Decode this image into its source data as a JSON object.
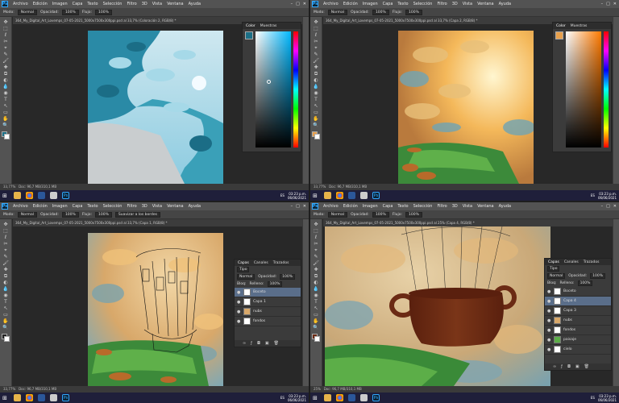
{
  "app": {
    "logo": "Ps",
    "menu": [
      "Archivo",
      "Edición",
      "Imagen",
      "Capa",
      "Texto",
      "Selección",
      "Filtro",
      "3D",
      "Vista",
      "Ventana",
      "Ayuda"
    ],
    "win_controls": [
      "–",
      "□",
      "✕"
    ],
    "options": {
      "mode_label": "Modo:",
      "mode_value": "Normal",
      "opacity_label": "Opacidad:",
      "opacity_value": "100%",
      "flow_label": "Flujo:",
      "flow_value": "100%"
    },
    "options_extra": "Suavizar a los bordes"
  },
  "tools": [
    "✥",
    "⬚",
    "ℓ",
    "✂",
    "⌖",
    "✎",
    "🖌",
    "✚",
    "⧉",
    "◐",
    "💧",
    "◉",
    "T",
    "↖",
    "▭",
    "✋",
    "🔍"
  ],
  "colors": {
    "brand": "#31a8ff",
    "menubar": "#535353",
    "taskbar": "#1f1f3a",
    "layer_selected": "#5a6e8a"
  },
  "quadrants": [
    {
      "tab": "364_My_Digital_Art_Lovemps_07-05-2021_5000x7500x300ppi.psd al 33,7% (Coloración 2, RGB/8) *",
      "status": "33,77%",
      "status_doc": "Doc: 96,7 MB/310,1 MB",
      "panel_tabs": [
        "Color",
        "Muestras"
      ]
    },
    {
      "tab": "364_My_Digital_Art_Lovemps_07-05-2021_5000x7500x300ppi.psd al 33,7% (Capa 2, RGB/8) *",
      "status": "33,77%",
      "status_doc": "Doc: 96,7 MB/310,1 MB",
      "panel_tabs": [
        "Color",
        "Muestras"
      ]
    },
    {
      "tab": "364_My_Digital_Art_Lovemps_07-05-2021_5000x7500x300ppi.psd al 33,7% (Capa 1, RGB/8) *",
      "status": "33,77%",
      "status_doc": "Doc: 96,7 MB/310,1 MB",
      "panel_tabs": [
        "Capas",
        "Canales",
        "Trazados"
      ],
      "layers_kind": "Tipo",
      "blend": "Normal",
      "opacity_label": "Opacidad:",
      "opacity": "100%",
      "lock_label": "Bloq:",
      "fill_label": "Relleno:",
      "fill": "100%",
      "layers": [
        "Boceto",
        "Capa 1",
        "nubs",
        "fondos"
      ]
    },
    {
      "tab": "364_My_Digital_Art_Lovemps_07-05-2021_5000x7500x300ppi.psd al 25% (Capa 4, RGB/8) *",
      "status": "25%",
      "status_doc": "Doc: 96,7 MB/310,1 MB",
      "panel_tabs": [
        "Capas",
        "Canales",
        "Trazados"
      ],
      "layers_kind": "Tipo",
      "blend": "Normal",
      "opacity_label": "Opacidad:",
      "opacity": "100%",
      "lock_label": "Bloq:",
      "fill_label": "Relleno:",
      "fill": "100%",
      "layers": [
        "Boceto",
        "Capa 4",
        "Capa 3",
        "nubs",
        "fondos",
        "paisaje",
        "cielo"
      ]
    }
  ],
  "taskbar": {
    "start": "⊞",
    "lang": "ES",
    "time": "03:23 p.m.",
    "date": "06/06/2021",
    "apps": [
      "folder",
      "chrome",
      "word",
      "notes",
      "photoshop"
    ],
    "ps": "Ps"
  }
}
